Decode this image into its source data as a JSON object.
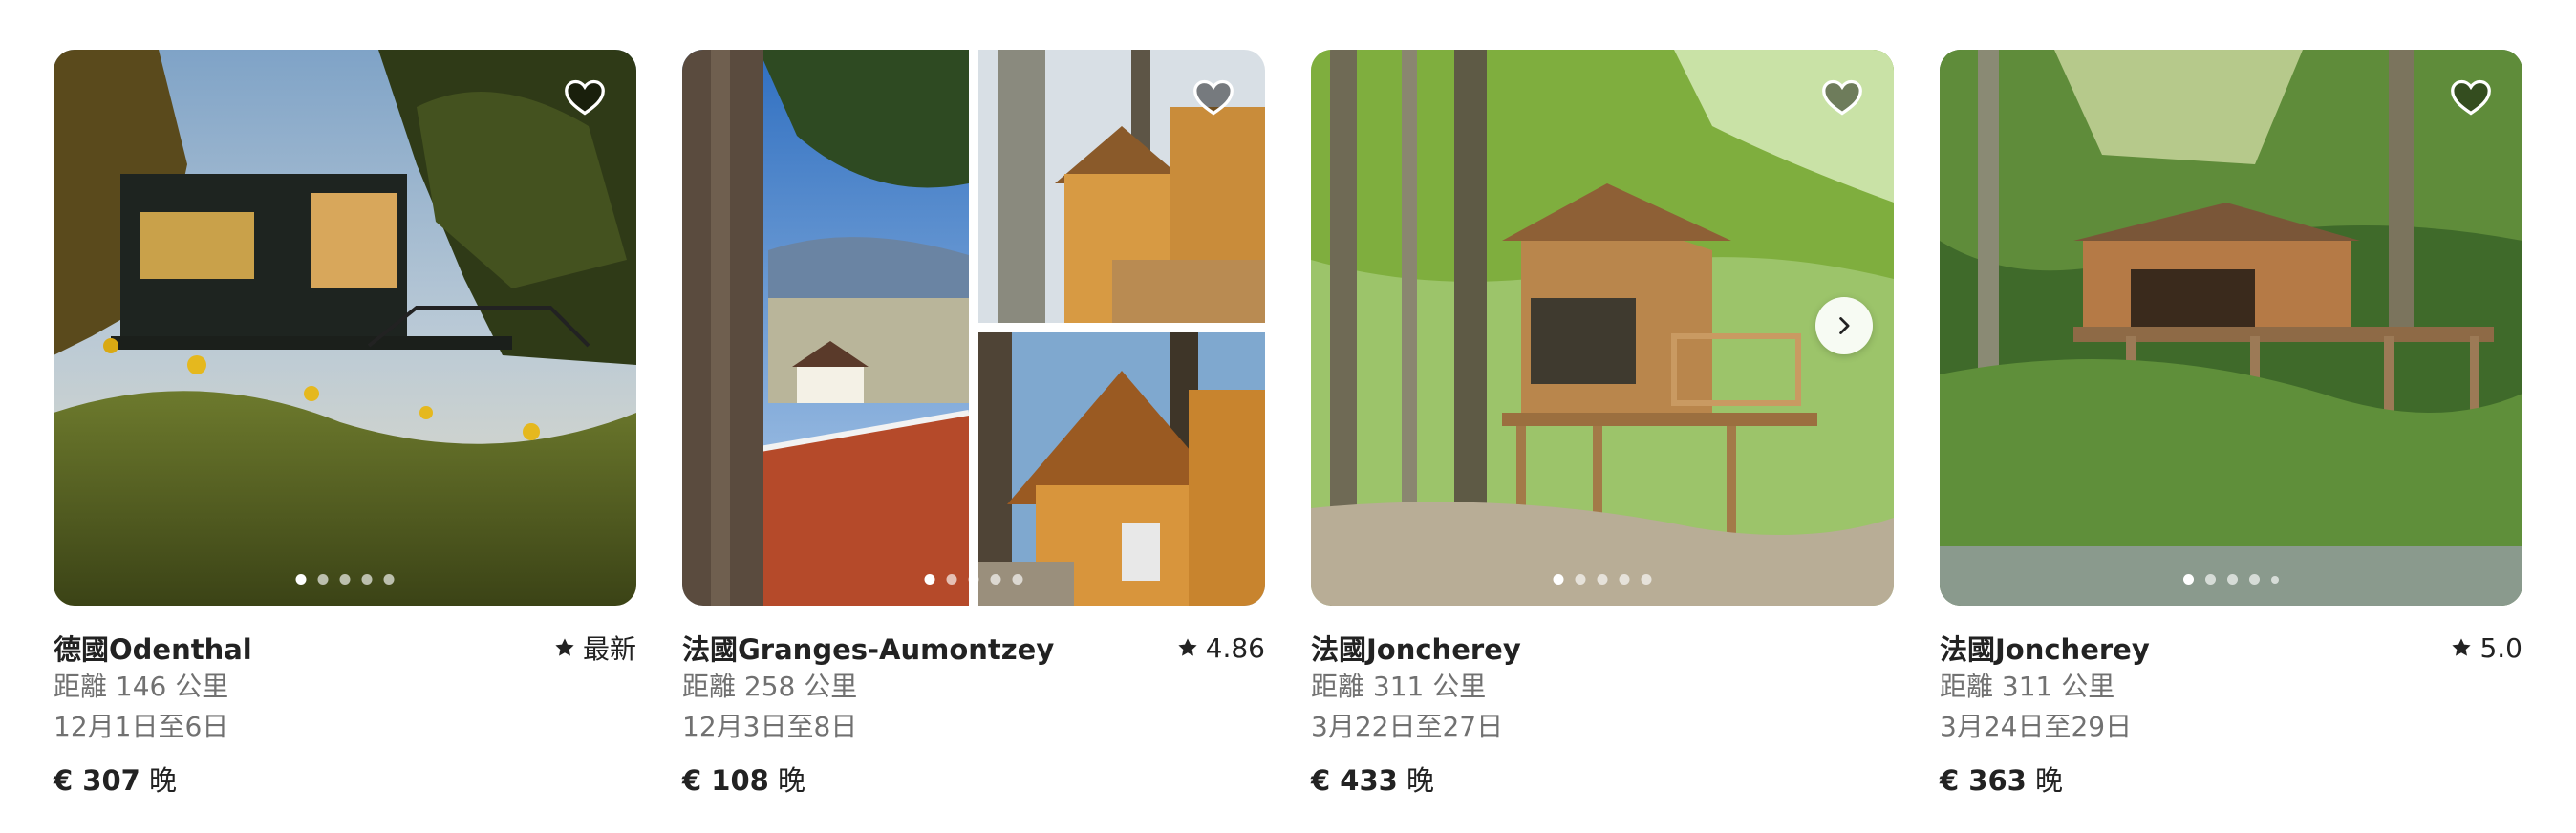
{
  "listings": [
    {
      "title": "德國Odenthal",
      "rating": "最新",
      "distance": "距離 146 公里",
      "dates": "12月1日至6日",
      "price_amount": "€ 307",
      "price_unit": "晚",
      "photo_count": 5,
      "active_photo": 1
    },
    {
      "title": "法國Granges-Aumontzey",
      "rating": "4.86",
      "distance": "距離 258 公里",
      "dates": "12月3日至8日",
      "price_amount": "€ 108",
      "price_unit": "晚",
      "photo_count": 5,
      "active_photo": 1
    },
    {
      "title": "法國Joncherey",
      "rating": "",
      "distance": "距離 311 公里",
      "dates": "3月22日至27日",
      "price_amount": "€ 433",
      "price_unit": "晚",
      "photo_count": 5,
      "active_photo": 1
    },
    {
      "title": "法國Joncherey",
      "rating": "5.0",
      "distance": "距離 311 公里",
      "dates": "3月24日至29日",
      "price_amount": "€ 363",
      "price_unit": "晚",
      "photo_count": 5,
      "active_photo": 1
    }
  ],
  "icons": {
    "favorite": "heart-outline-icon",
    "rating": "star-icon",
    "next": "chevron-right-icon"
  },
  "colors": {
    "primary_text": "#222222",
    "secondary_text": "#717171"
  }
}
